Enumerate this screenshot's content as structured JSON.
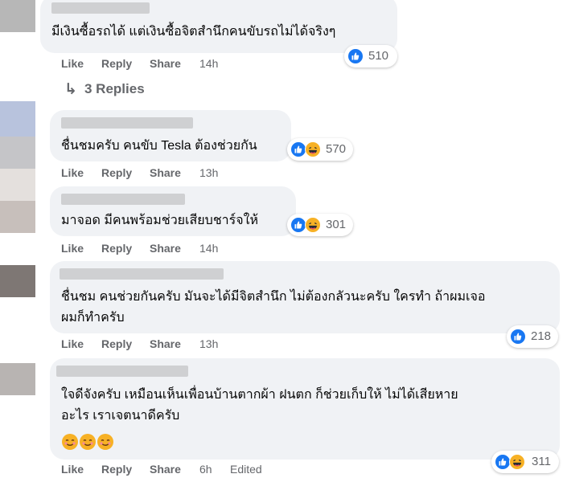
{
  "comments": [
    {
      "text": "มีเงินซื้อรถได้ แต่เงินซื้อจิตสำนึกคนขับรถไม่ได้จริงๆ",
      "actions": {
        "like": "Like",
        "reply": "Reply",
        "share": "Share",
        "time": "14h"
      },
      "reaction_count": "510",
      "reaction_icons": [
        "like-icon"
      ]
    },
    {
      "text": "ชื่นชมครับ คนขับ Tesla ต้องช่วยกัน",
      "actions": {
        "like": "Like",
        "reply": "Reply",
        "share": "Share",
        "time": "13h"
      },
      "reaction_count": "570",
      "reaction_icons": [
        "like-icon",
        "haha-icon"
      ]
    },
    {
      "text": "มาจอด มีคนพร้อมช่วยเสียบชาร์จให้",
      "actions": {
        "like": "Like",
        "reply": "Reply",
        "share": "Share",
        "time": "14h"
      },
      "reaction_count": "301",
      "reaction_icons": [
        "like-icon",
        "haha-icon"
      ]
    },
    {
      "text_lines": [
        "ชื่นชม คนช่วยกันครับ มันจะได้มีจิตสำนึก ไม่ต้องกลัวนะครับ ใครทำ ถ้าผมเจอ",
        "ผมก็ทำครับ"
      ],
      "actions": {
        "like": "Like",
        "reply": "Reply",
        "share": "Share",
        "time": "13h"
      },
      "reaction_count": "218",
      "reaction_icons": [
        "like-icon"
      ]
    },
    {
      "text_lines": [
        "ใจดีจังครับ เหมือนเห็นเพื่อนบ้านตากผ้า ฝนตก ก็ช่วยเก็บให้ ไม่ได้เสียหาย",
        "อะไร เราเจตนาดีครับ"
      ],
      "emoji_line": [
        "smiling-face-icon",
        "smiling-face-icon",
        "smiling-face-icon"
      ],
      "actions": {
        "like": "Like",
        "reply": "Reply",
        "share": "Share",
        "time": "6h",
        "edited": "Edited"
      },
      "reaction_count": "311",
      "reaction_icons": [
        "like-icon",
        "haha-icon"
      ]
    }
  ],
  "replies_link": {
    "arrow": "↳",
    "label": "3 Replies"
  },
  "colors": {
    "bubble": "#f0f2f5",
    "secondary_text": "#65676b",
    "like_blue": "#1877f2",
    "haha_yellow": "#f7b125"
  }
}
